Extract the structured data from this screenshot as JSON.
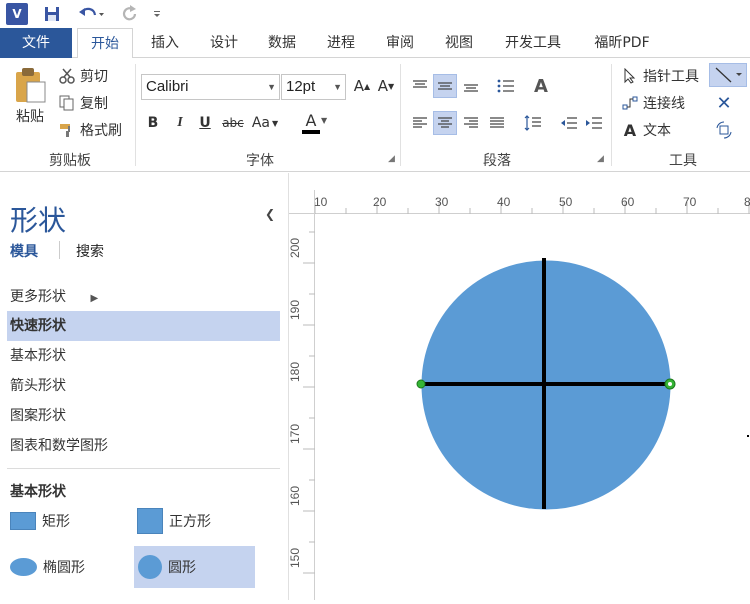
{
  "qat": {
    "app_icon": "visio-icon",
    "app_letter": "V",
    "save": "save-icon",
    "undo": "undo-icon",
    "redo": "redo-icon",
    "more": "customize-icon"
  },
  "tabs": [
    {
      "label": "文件"
    },
    {
      "label": "开始"
    },
    {
      "label": "插入"
    },
    {
      "label": "设计"
    },
    {
      "label": "数据"
    },
    {
      "label": "进程"
    },
    {
      "label": "审阅"
    },
    {
      "label": "视图"
    },
    {
      "label": "开发工具"
    },
    {
      "label": "福昕PDF"
    }
  ],
  "ribbon": {
    "clipboard": {
      "label": "剪贴板",
      "paste": "粘贴",
      "cut": "剪切",
      "copy": "复制",
      "format_painter": "格式刷"
    },
    "font": {
      "label": "字体",
      "family": "Calibri",
      "size": "12pt",
      "grow": "A",
      "shrink": "A",
      "bold": "B",
      "italic": "I",
      "underline": "U",
      "strike": "abc",
      "case": "Aa",
      "color": "A"
    },
    "paragraph": {
      "label": "段落"
    },
    "tools": {
      "label": "工具",
      "pointer": "指针工具",
      "connector": "连接线",
      "text": "文本",
      "text_glyph": "A"
    }
  },
  "pane": {
    "title": "形状",
    "tabs": [
      "模具",
      "搜索"
    ],
    "items": [
      "更多形状",
      "快速形状",
      "基本形状",
      "箭头形状",
      "图案形状",
      "图表和数学图形"
    ],
    "stencil_title": "基本形状",
    "shapes": [
      "矩形",
      "正方形",
      "椭圆形",
      "圆形"
    ]
  },
  "ruler": {
    "h_ticks": [
      "10",
      "20",
      "30",
      "40",
      "50",
      "60",
      "70",
      "8"
    ],
    "v_ticks": [
      "200",
      "190",
      "180",
      "170",
      "160",
      "150"
    ]
  },
  "colors": {
    "accent": "#2b579a",
    "selection": "#c5d3ef",
    "shape_fill": "#5b9bd5"
  }
}
